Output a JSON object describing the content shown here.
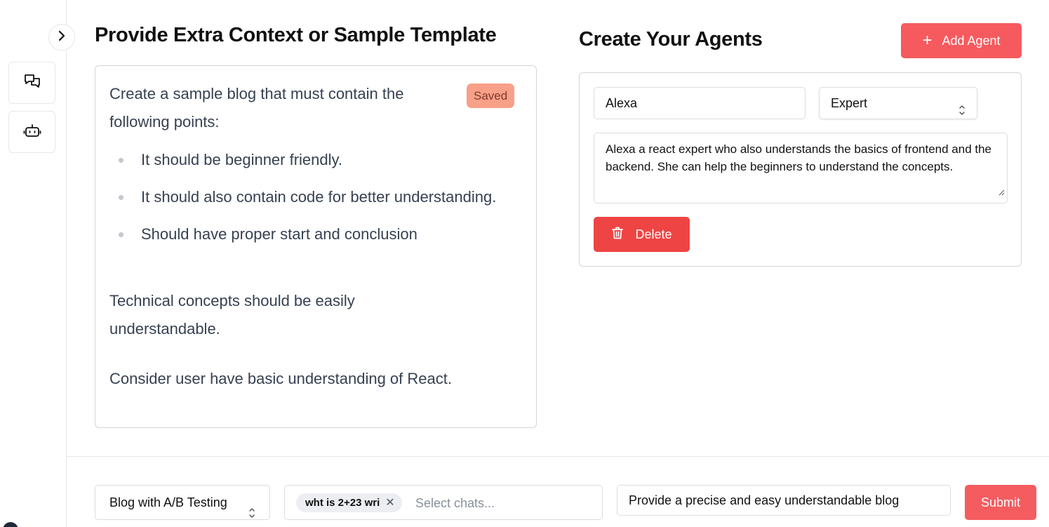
{
  "sidebar": {
    "items": [
      {
        "icon": "chat-bubbles-icon"
      },
      {
        "icon": "robot-icon"
      }
    ],
    "collapse_icon": "chevron-right-icon"
  },
  "context": {
    "title": "Provide Extra Context or Sample Template",
    "saved_badge": "Saved",
    "intro": "Create a sample blog that must contain the following points:",
    "bullets": [
      "It should be beginner friendly.",
      "It should also contain code for better understanding.",
      "Should have proper start and conclusion"
    ],
    "paragraph_1": "Technical concepts should be easily understandable.",
    "paragraph_2": "Consider user have basic understanding of React."
  },
  "agents": {
    "title": "Create Your Agents",
    "add_button_label": "Add Agent",
    "list": [
      {
        "name": "Alexa",
        "role": "Expert",
        "description": "Alexa a react expert who also understands the basics of frontend and the backend. She can help the beginners to understand the concepts.",
        "delete_label": "Delete"
      }
    ]
  },
  "bottom_bar": {
    "template_select": "Blog with A/B Testing",
    "chat_chip": "wht is 2+23 wri",
    "chat_placeholder": "Select chats...",
    "prompt_value": "Provide a precise and easy understandable blog",
    "submit_label": "Submit"
  },
  "colors": {
    "accent": "#f65a5e",
    "danger": "#ef4444",
    "badge_bg": "#f9a088",
    "border": "#d1d5db"
  }
}
